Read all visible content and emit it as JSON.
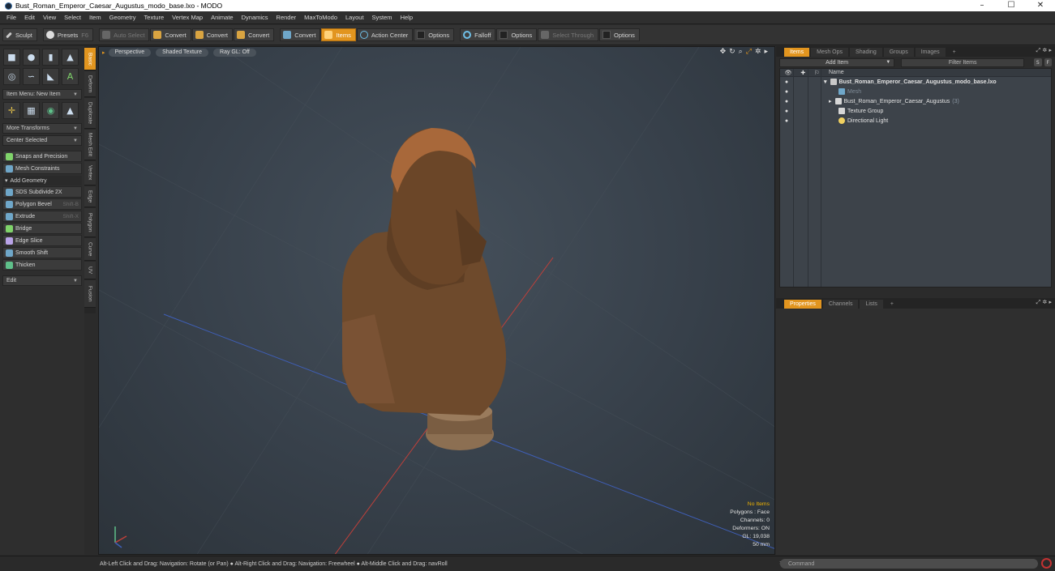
{
  "window": {
    "title": "Bust_Roman_Emperor_Caesar_Augustus_modo_base.lxo - MODO",
    "controls": [
      "–",
      "☐",
      "✕"
    ]
  },
  "menu": [
    "File",
    "Edit",
    "View",
    "Select",
    "Item",
    "Geometry",
    "Texture",
    "Vertex Map",
    "Animate",
    "Dynamics",
    "Render",
    "MaxToModo",
    "Layout",
    "System",
    "Help"
  ],
  "toolbar": {
    "sculpt": "Sculpt",
    "presets": "Presets",
    "presets_shortcut": "F6",
    "auto_select": "Auto Select",
    "convert1": "Convert",
    "convert2": "Convert",
    "convert3": "Convert",
    "convert4": "Convert",
    "items": "Items",
    "action_center": "Action Center",
    "options1": "Options",
    "falloff": "Falloff",
    "options2": "Options",
    "select_through": "Select Through",
    "options3": "Options"
  },
  "left": {
    "item_menu": "Item Menu: New Item",
    "more_transforms": "More Transforms",
    "center_selected": "Center Selected",
    "snaps": "Snaps and Precision",
    "mesh_constraints": "Mesh Constraints",
    "add_geometry": "Add Geometry",
    "tools": [
      {
        "label": "SDS Subdivide 2X",
        "shortcut": ""
      },
      {
        "label": "Polygon Bevel",
        "shortcut": "Shift-B"
      },
      {
        "label": "Extrude",
        "shortcut": "Shift-X"
      },
      {
        "label": "Bridge",
        "shortcut": ""
      },
      {
        "label": "Edge Slice",
        "shortcut": ""
      },
      {
        "label": "Smooth Shift",
        "shortcut": ""
      },
      {
        "label": "Thicken",
        "shortcut": ""
      }
    ],
    "edit": "Edit"
  },
  "vtabs": [
    "Basic",
    "Deform",
    "Duplicate",
    "Mesh Edit",
    "Vertex",
    "Edge",
    "Polygon",
    "Curve",
    "UV",
    "Fusion"
  ],
  "viewport": {
    "view": "Perspective",
    "shading": "Shaded Texture",
    "raygl": "Ray GL: Off",
    "stats": {
      "selection": "No Items",
      "polygons": "Polygons : Face",
      "channels": "Channels: 0",
      "deformers": "Deformers: ON",
      "gl": "GL: 19,038",
      "scale": "50 mm"
    }
  },
  "items_panel": {
    "tabs": [
      "Items",
      "Mesh Ops",
      "Shading",
      "Groups",
      "Images",
      "+"
    ],
    "add_item": "Add Item",
    "filter": "Filter Items",
    "s_btn": "S",
    "f_btn": "F",
    "name_col": "Name",
    "rows": [
      {
        "label": "Bust_Roman_Emperor_Caesar_Augustus_modo_base.lxo",
        "count": ""
      },
      {
        "label": "Mesh",
        "count": ""
      },
      {
        "label": "Bust_Roman_Emperor_Caesar_Augustus",
        "count": "(3)"
      },
      {
        "label": "Texture Group",
        "count": ""
      },
      {
        "label": "Directional Light",
        "count": ""
      }
    ]
  },
  "props_panel": {
    "tabs": [
      "Properties",
      "Channels",
      "Lists",
      "+"
    ]
  },
  "status": {
    "hint": "Alt-Left Click and Drag: Navigation: Rotate (or Pan) ● Alt-Right Click and Drag: Navigation: Freewheel ● Alt-Middle Click and Drag: navRoll",
    "command_placeholder": "Command"
  },
  "colors": {
    "accent": "#e2951f",
    "bust": "#8a5a32",
    "axis_x": "#c0403a",
    "axis_z": "#3f5fb8"
  }
}
